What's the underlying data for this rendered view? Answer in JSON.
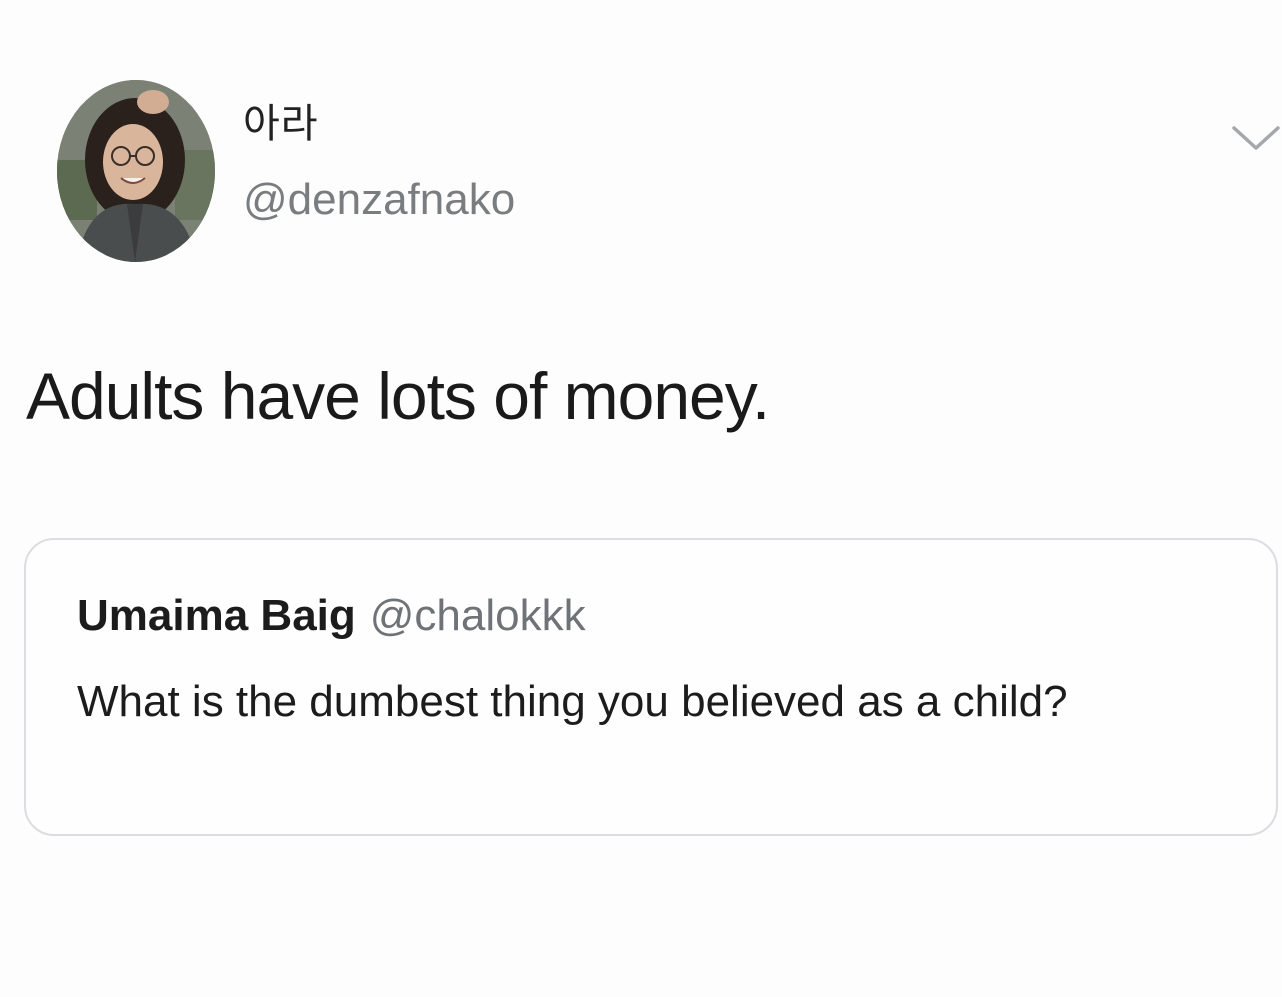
{
  "tweet": {
    "author": {
      "display_name": "아라",
      "handle": "@denzafnako",
      "avatar_icon": "profile-photo"
    },
    "menu_icon": "chevron-down-icon",
    "text": "Adults have lots of money.",
    "quoted_tweet": {
      "author_name": "Umaima Baig",
      "author_handle": "@chalokkk",
      "text": "What is the dumbest thing you believed as a child?"
    }
  },
  "colors": {
    "background": "#fdfdfd",
    "primary_text": "#1a1a1a",
    "secondary_text": "#7a7d80",
    "border": "#dcdde0"
  }
}
